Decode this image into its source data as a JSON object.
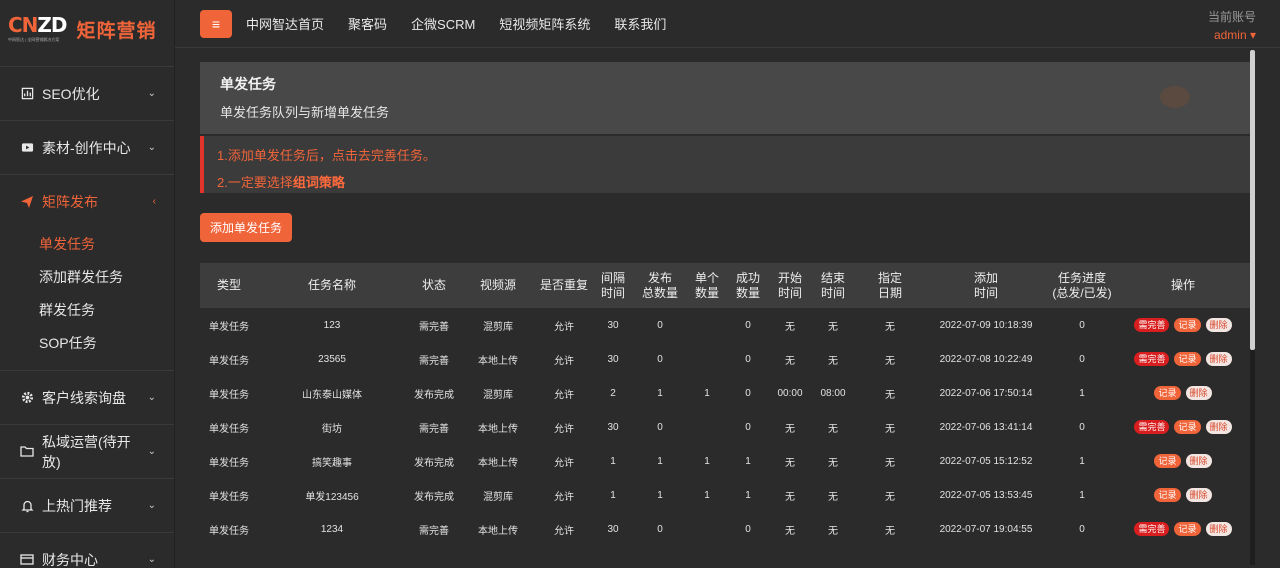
{
  "logo": {
    "mark": "CN",
    "mark2": "ZD",
    "sub": "中网智达 | 全网营销解决方案",
    "title": "矩阵营销"
  },
  "sidebar": {
    "items": [
      {
        "label": "SEO优化",
        "icon": "report-icon"
      },
      {
        "label": "素材-创作中心",
        "icon": "video-icon"
      },
      {
        "label": "矩阵发布",
        "icon": "send-icon",
        "active": true
      },
      {
        "label": "客户线索询盘",
        "icon": "gear-icon"
      },
      {
        "label": "私域运营(待开放)",
        "icon": "folder-icon"
      },
      {
        "label": "上热门推荐",
        "icon": "bell-icon"
      },
      {
        "label": "财务中心",
        "icon": "wallet-icon"
      }
    ],
    "submenu": [
      "单发任务",
      "添加群发任务",
      "群发任务",
      "SOP任务"
    ]
  },
  "topbar": {
    "nav": [
      "中网智达首页",
      "聚客码",
      "企微SCRM",
      "短视频矩阵系统",
      "联系我们"
    ],
    "account_label": "当前账号",
    "account_user": "admin"
  },
  "page": {
    "title": "单发任务",
    "subtitle": "单发任务队列与新增单发任务",
    "notice1": "1.添加单发任务后，点击去完善任务。",
    "notice2_prefix": "2.一定要选择",
    "notice2_bold": "组词策略",
    "add_button": "添加单发任务"
  },
  "table": {
    "headers": [
      "类型",
      "任务名称",
      "状态",
      "视频源",
      "是否重复",
      "间隔\n时间",
      "发布\n总数量",
      "单个\n数量",
      "成功\n数量",
      "开始\n时间",
      "结束\n时间",
      "指定\n日期",
      "添加\n时间",
      "任务进度\n(总发/已发)",
      "操作"
    ],
    "rows": [
      [
        "单发任务",
        "123",
        "需完善",
        "混剪库",
        "允许",
        "30",
        "0",
        "",
        "0",
        "无",
        "无",
        "无",
        "2022-07-09 10:18:39",
        "0",
        true
      ],
      [
        "单发任务",
        "23565",
        "需完善",
        "本地上传",
        "允许",
        "30",
        "0",
        "",
        "0",
        "无",
        "无",
        "无",
        "2022-07-08 10:22:49",
        "0",
        true
      ],
      [
        "单发任务",
        "山东泰山媒体",
        "发布完成",
        "混剪库",
        "允许",
        "2",
        "1",
        "1",
        "0",
        "00:00",
        "08:00",
        "无",
        "2022-07-06 17:50:14",
        "1",
        false
      ],
      [
        "单发任务",
        "街坊",
        "需完善",
        "本地上传",
        "允许",
        "30",
        "0",
        "",
        "0",
        "无",
        "无",
        "无",
        "2022-07-06 13:41:14",
        "0",
        true
      ],
      [
        "单发任务",
        "搞笑趣事",
        "发布完成",
        "本地上传",
        "允许",
        "1",
        "1",
        "1",
        "1",
        "无",
        "无",
        "无",
        "2022-07-05 15:12:52",
        "1",
        false
      ],
      [
        "单发任务",
        "单发123456",
        "发布完成",
        "混剪库",
        "允许",
        "1",
        "1",
        "1",
        "1",
        "无",
        "无",
        "无",
        "2022-07-05 13:53:45",
        "1",
        false
      ],
      [
        "单发任务",
        "1234",
        "需完善",
        "本地上传",
        "允许",
        "30",
        "0",
        "",
        "0",
        "无",
        "无",
        "无",
        "2022-07-07 19:04:55",
        "0",
        true
      ]
    ],
    "btn_need": "需完善",
    "btn_record": "记录",
    "btn_delete": "删除"
  },
  "colors": {
    "accent": "#f0643a",
    "danger": "#d81e1e",
    "bg": "#2b2b2b"
  }
}
